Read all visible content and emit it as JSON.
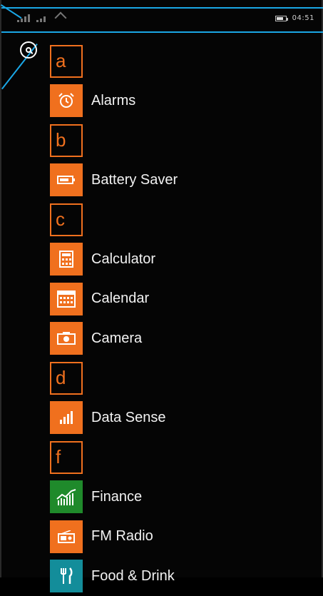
{
  "status_bar": {
    "time": "04:51",
    "battery_level": 0.7
  },
  "colors": {
    "accent_orange": "#f0701e",
    "finance_green": "#1f8a2b",
    "food_teal": "#138d9a",
    "annotation_blue": "#1aa7e6"
  },
  "apps": {
    "letter_a": "a",
    "alarms": "Alarms",
    "letter_b": "b",
    "battery_saver": "Battery Saver",
    "letter_c": "c",
    "calculator": "Calculator",
    "calendar": "Calendar",
    "camera": "Camera",
    "letter_d": "d",
    "data_sense": "Data Sense",
    "letter_f": "f",
    "finance": "Finance",
    "fm_radio": "FM Radio",
    "food_drink": "Food & Drink"
  },
  "icons": {
    "search": "search-icon",
    "alarms": "alarm-clock-icon",
    "battery_saver": "battery-icon",
    "calculator": "calculator-icon",
    "calendar": "calendar-icon",
    "camera": "camera-icon",
    "data_sense": "signal-bars-icon",
    "finance": "stock-chart-icon",
    "fm_radio": "radio-icon",
    "food_drink": "fork-knife-icon"
  }
}
